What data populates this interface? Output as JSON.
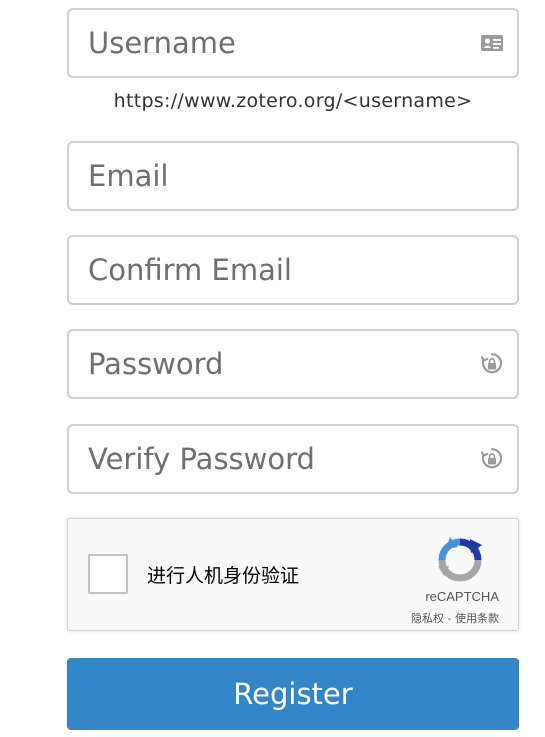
{
  "form": {
    "username": {
      "placeholder": "Username",
      "value": "",
      "icon": "id-card-icon"
    },
    "username_hint": "https://www.zotero.org/<username>",
    "email": {
      "placeholder": "Email",
      "value": ""
    },
    "confirm_email": {
      "placeholder": "Confirm Email",
      "value": ""
    },
    "password": {
      "placeholder": "Password",
      "value": "",
      "icon": "password-lock-icon"
    },
    "verify_password": {
      "placeholder": "Verify Password",
      "value": "",
      "icon": "password-lock-icon"
    },
    "register_label": "Register"
  },
  "captcha": {
    "checkbox_label": "进行人机身份验证",
    "brand": "reCAPTCHA",
    "privacy_link": "隐私权",
    "separator": " - ",
    "terms_link": "使用条款",
    "icon": "recaptcha-logo-icon"
  },
  "colors": {
    "button_bg": "#3286c8",
    "field_border": "#cfcfcf",
    "icon_gray": "#9a9a9a",
    "recaptcha_blue": "#1c3aa9",
    "recaptcha_light_blue": "#4a90e2",
    "recaptcha_gray": "#a6a6a6"
  }
}
